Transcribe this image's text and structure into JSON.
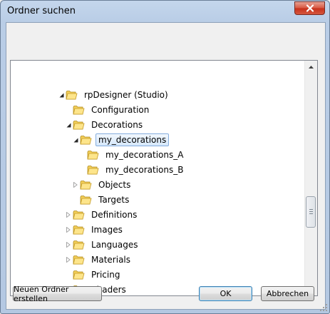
{
  "window": {
    "title": "Ordner suchen"
  },
  "tree": {
    "items": [
      {
        "label": "rpDesigner (Studio)",
        "level": 0,
        "expander": "expanded",
        "selected": false
      },
      {
        "label": "Configuration",
        "level": 1,
        "expander": "none",
        "selected": false
      },
      {
        "label": "Decorations",
        "level": 1,
        "expander": "expanded",
        "selected": false
      },
      {
        "label": "my_decorations",
        "level": 2,
        "expander": "expanded",
        "selected": true
      },
      {
        "label": "my_decorations_A",
        "level": 3,
        "expander": "none",
        "selected": false
      },
      {
        "label": "my_decorations_B",
        "level": 3,
        "expander": "none",
        "selected": false
      },
      {
        "label": "Objects",
        "level": 2,
        "expander": "collapsed",
        "selected": false
      },
      {
        "label": "Targets",
        "level": 2,
        "expander": "none",
        "selected": false
      },
      {
        "label": "Definitions",
        "level": 1,
        "expander": "collapsed",
        "selected": false
      },
      {
        "label": "Images",
        "level": 1,
        "expander": "collapsed",
        "selected": false
      },
      {
        "label": "Languages",
        "level": 1,
        "expander": "collapsed",
        "selected": false
      },
      {
        "label": "Materials",
        "level": 1,
        "expander": "collapsed",
        "selected": false
      },
      {
        "label": "Pricing",
        "level": 1,
        "expander": "none",
        "selected": false
      },
      {
        "label": "Shaders",
        "level": 1,
        "expander": "none",
        "selected": false
      }
    ],
    "scroll_position": 0.62
  },
  "buttons": {
    "new_folder": "Neuen Ordner erstellen",
    "ok": "OK",
    "cancel": "Abbrechen"
  },
  "colors": {
    "folder": "#f3cf5a",
    "selection_border": "#84acdd",
    "close_button": "#c7301a"
  }
}
